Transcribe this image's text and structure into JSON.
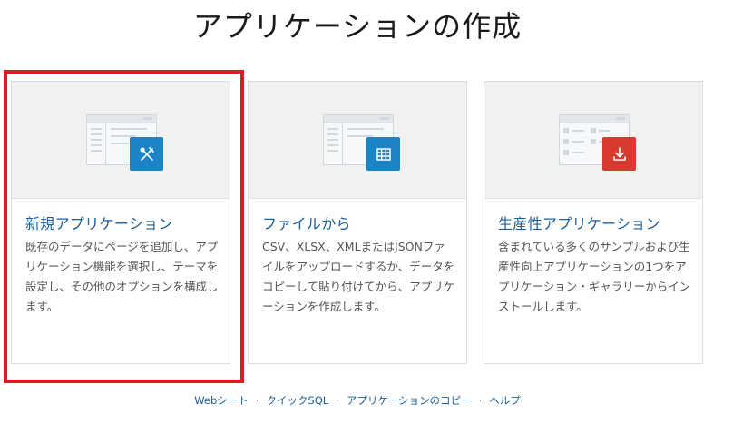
{
  "page": {
    "title": "アプリケーションの作成"
  },
  "cards": [
    {
      "title": "新規アプリケーション",
      "description": "既存のデータにページを追加し、アプリケーション機能を選択し、テーマを設定し、その他のオプションを構成します。",
      "icon": "wrench-pencil-icon",
      "badge_color": "#1a84c7"
    },
    {
      "title": "ファイルから",
      "description": "CSV、XLSX、XMLまたはJSONファイルをアップロードするか、データをコピーして貼り付けてから、アプリケーションを作成します。",
      "icon": "table-grid-icon",
      "badge_color": "#1a84c7"
    },
    {
      "title": "生産性アプリケーション",
      "description": "含まれている多くのサンプルおよび生産性向上アプリケーションの1つをアプリケーション・ギャラリーからインストールします。",
      "icon": "download-icon",
      "badge_color": "#d93a2f"
    }
  ],
  "footer": {
    "links": [
      "Webシート",
      "クイックSQL",
      "アプリケーションのコピー",
      "ヘルプ"
    ],
    "separator": "·"
  },
  "colors": {
    "link": "#1a5f99",
    "highlight": "#e11a22"
  }
}
